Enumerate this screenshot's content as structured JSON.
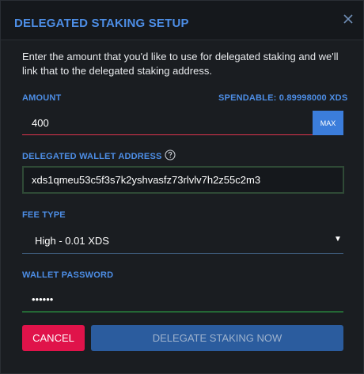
{
  "dialog": {
    "title": "DELEGATED STAKING SETUP",
    "intro": "Enter the amount that you'd like to use for delegated staking and we'll link that to the delegated staking address."
  },
  "amount": {
    "label": "AMOUNT",
    "spendable": "SPENDABLE: 0.89998000 XDS",
    "value": "400",
    "max_label": "MAX"
  },
  "wallet_address": {
    "label": "DELEGATED WALLET ADDRESS",
    "value": "xds1qmeu53c5f3s7k2yshvasfz73rlvlv7h2z55c2m3"
  },
  "fee": {
    "label": "FEE TYPE",
    "selected": "High - 0.01 XDS"
  },
  "password": {
    "label": "WALLET PASSWORD",
    "value": "••••••"
  },
  "actions": {
    "cancel": "CANCEL",
    "delegate": "DELEGATE STAKING NOW"
  },
  "icons": {
    "close": "close-icon",
    "help": "help-circle-icon",
    "caret": "caret-down-icon"
  },
  "colors": {
    "accent": "#4d8ee6",
    "danger": "#e0134a",
    "primary": "#2b5c9e",
    "valid": "#2fbf4c"
  }
}
